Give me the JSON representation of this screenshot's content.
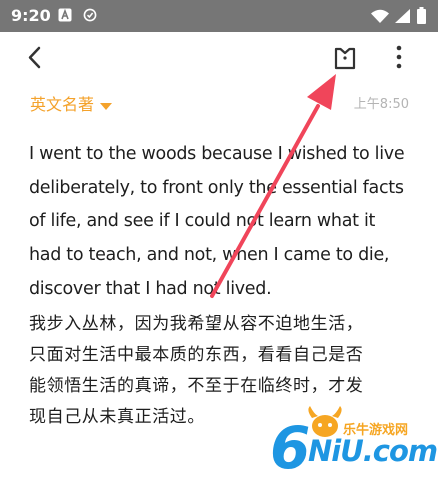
{
  "status_bar": {
    "time": "9:20",
    "left_icons": [
      "a-square-icon",
      "sync-circle-icon"
    ],
    "right_icons": [
      "wifi-icon",
      "signal-icon",
      "battery-icon"
    ]
  },
  "toolbar": {
    "icons": [
      "back-arrow-icon",
      "bookmark-tag-icon",
      "more-vert-icon"
    ]
  },
  "note": {
    "folder": "英文名著",
    "time": "上午8:50",
    "lines_en": [
      "I went to the woods because I wished to live",
      "deliberately, to front only the essential facts",
      "of life, and see if I could not learn what it",
      "had to teach, and not, when I came to die,",
      "discover that I had not lived."
    ],
    "lines_zh": [
      "我步入丛林，因为我希望从容不迫地生活，",
      "只面对生活中最本质的东西，看看自己是否",
      "能领悟生活的真谛，不至于在临终时，才发",
      "现自己从未真正活过。"
    ]
  },
  "watermark": {
    "cn": "乐牛游戏网",
    "en": "NiU.com",
    "digit": "6"
  },
  "colors": {
    "status_bar": "#767676",
    "accent": "#f4a22b",
    "arrow": "#f0455a",
    "watermark_blue": "#1e96e2",
    "watermark_orange": "#f6a623"
  }
}
